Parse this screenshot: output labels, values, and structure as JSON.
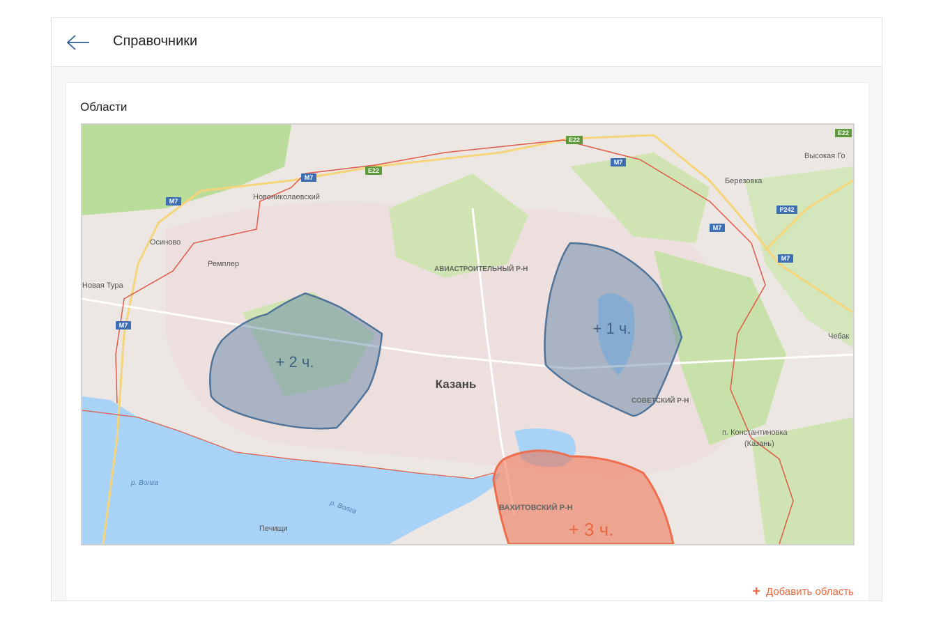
{
  "header": {
    "title": "Справочники"
  },
  "section": {
    "title": "Области"
  },
  "map": {
    "city_label": "Казань",
    "places": {
      "novonikolaevsky": "Новониколаевский",
      "osinovo": "Осиново",
      "remplyor": "Ремплер",
      "novaya_tura": "Новая Тура",
      "aviastroitelny": "АВИАСТРОИТЕЛЬНЫЙ Р-Н",
      "berezovka": "Березовка",
      "vysokaya_gora": "Высокая Го",
      "chebaksa": "Чебак",
      "sovetsky": "СОВЕТСКИЙ Р-Н",
      "konstantinovka_1": "п. Константиновка",
      "konstantinovka_2": "(Казань)",
      "vakhitovsky": "ВАХИТОВСКИЙ Р-Н",
      "pechishchi": "Печищи",
      "volga_1": "р. Волга",
      "volga_2": "р. Волга"
    },
    "road_shields": {
      "m7": "M7",
      "e22": "E22",
      "p242": "P242"
    },
    "zones": [
      {
        "label": "+ 2 ч.",
        "color": "#5a7fa3"
      },
      {
        "label": "+ 1 ч.",
        "color": "#5a7fa3"
      },
      {
        "label": "+ 3 ч.",
        "color": "#ee6d4c"
      }
    ]
  },
  "actions": {
    "add_zone_label": "Добавить область",
    "plus": "+"
  },
  "colors": {
    "accent": "#e8683c",
    "water": "#a9d3f6",
    "park": "#c8e0a9",
    "urban": "#ebe0de"
  }
}
